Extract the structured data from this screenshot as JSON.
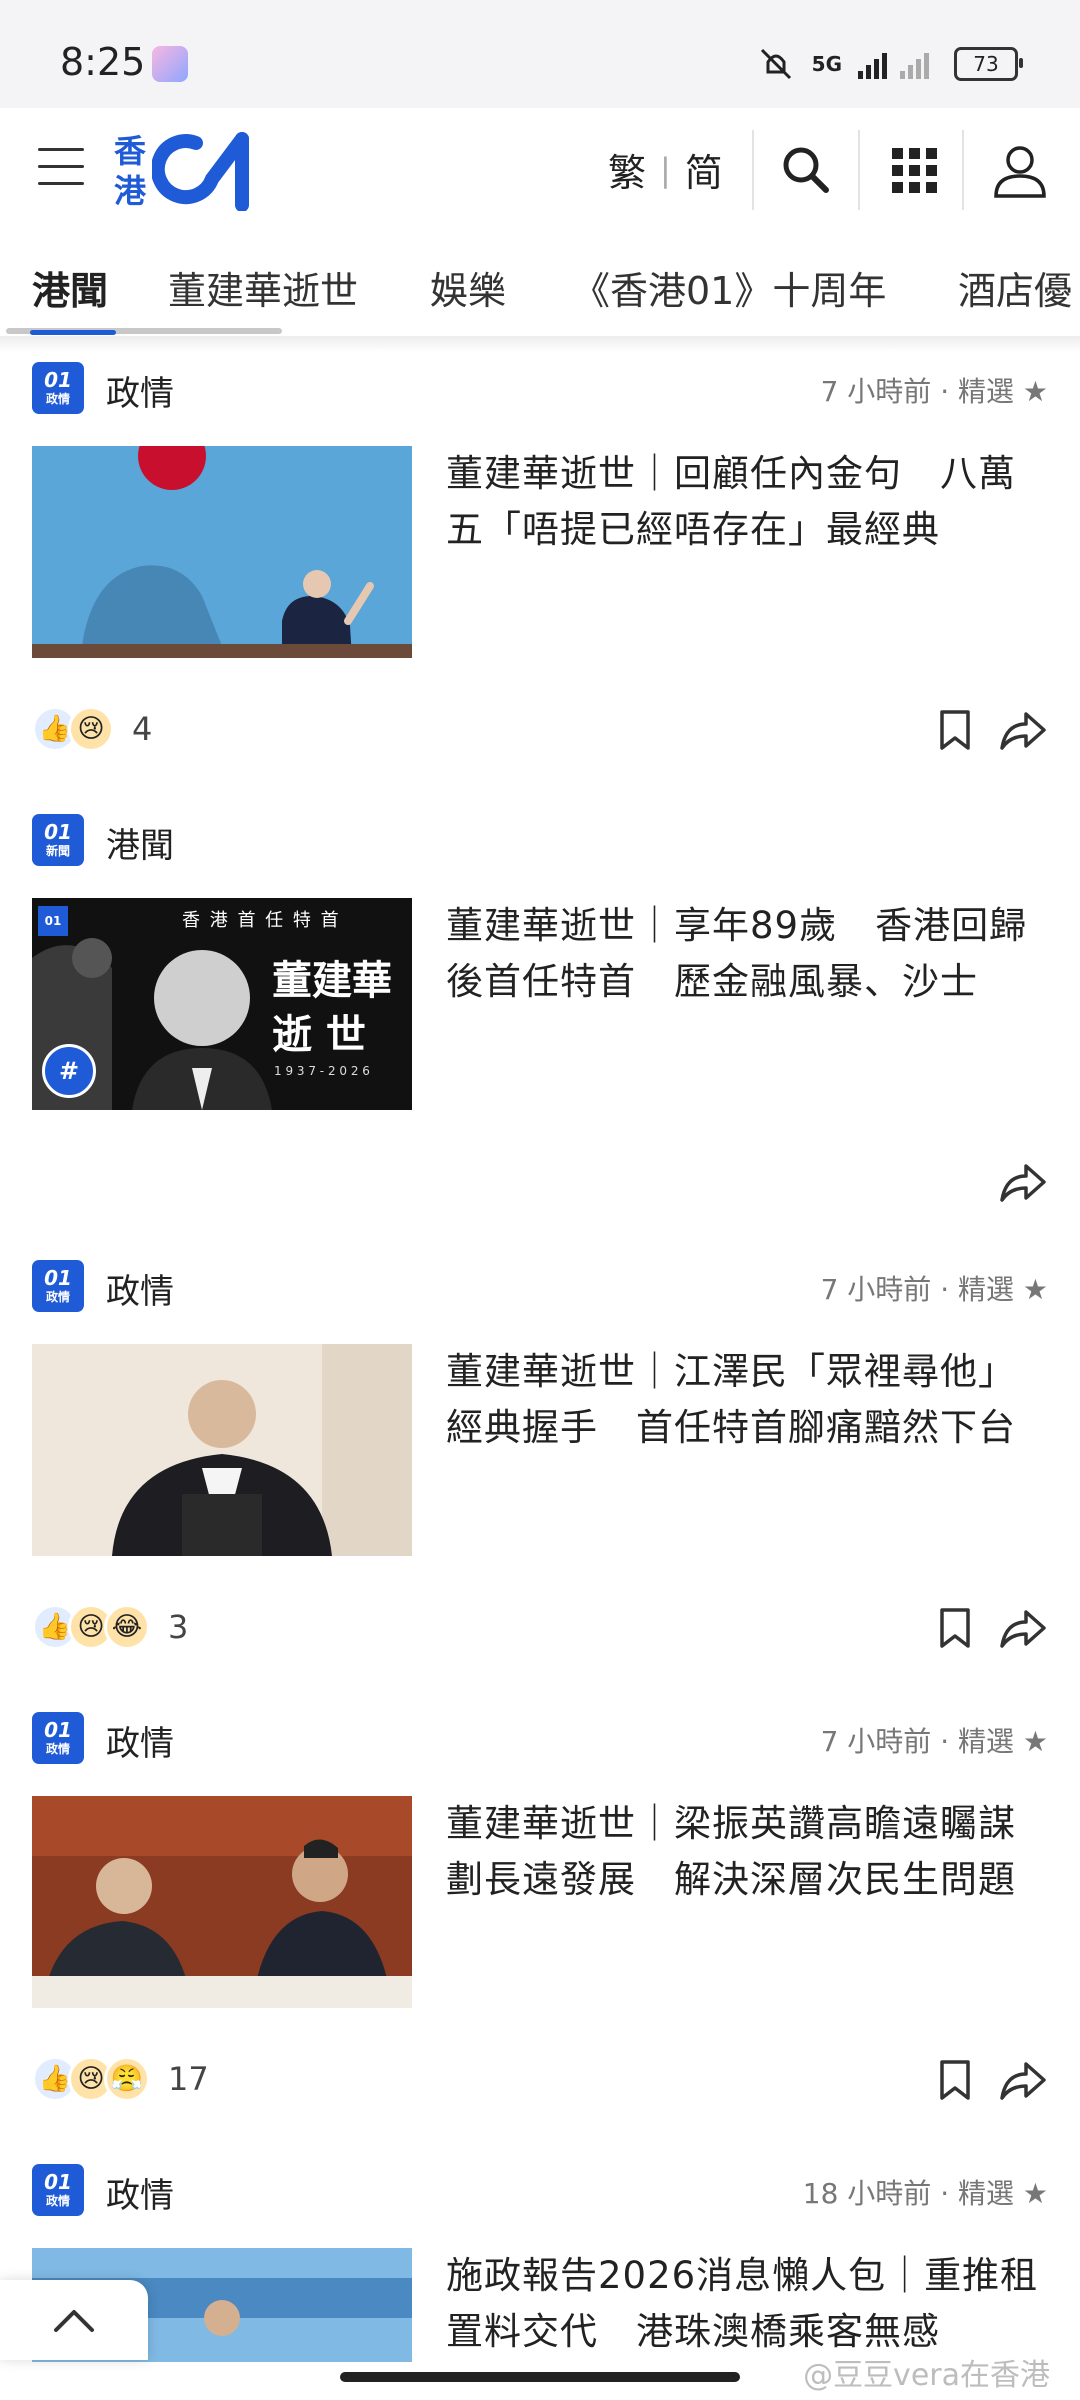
{
  "status_bar": {
    "time": "8:25",
    "network": "5G",
    "battery": "73"
  },
  "header": {
    "logo_cn_top": "香",
    "logo_cn_bottom": "港",
    "lang_trad": "繁",
    "lang_simp": "简"
  },
  "tabs": [
    {
      "label": "港聞",
      "active": true
    },
    {
      "label": "董建華逝世"
    },
    {
      "label": "娛樂"
    },
    {
      "label": "《香港01》十周年"
    },
    {
      "label": "酒店優"
    }
  ],
  "articles": [
    {
      "source_logo": "政情",
      "category": "政情",
      "meta": "7 小時前 · 精選 ★",
      "title": "董建華逝世｜回顧任內金句　八萬五「唔提已經唔存在」最經典",
      "reaction_count": "4"
    },
    {
      "source_logo": "新聞",
      "category": "港聞",
      "meta": "",
      "title": "董建華逝世｜享年89歲　香港回歸後首任特首　歷金融風暴、沙士",
      "thumb_header": "香 港 首 任 特 首",
      "thumb_name": "董建華",
      "thumb_event": "逝 世",
      "thumb_years": "1 9 3 7  -  2 0 2 6",
      "thumb_badge": "#"
    },
    {
      "source_logo": "政情",
      "category": "政情",
      "meta": "7 小時前 · 精選 ★",
      "title": "董建華逝世｜江澤民「眾裡尋他」經典握手　首任特首腳痛黯然下台",
      "reaction_count": "3"
    },
    {
      "source_logo": "政情",
      "category": "政情",
      "meta": "7 小時前 · 精選 ★",
      "title": "董建華逝世｜梁振英讚高瞻遠矚謀劃長遠發展　解決深層次民生問題",
      "reaction_count": "17"
    },
    {
      "source_logo": "政情",
      "category": "政情",
      "meta": "18 小時前 · 精選 ★",
      "title": "施政報告2026消息懶人包｜重推租置料交代　港珠澳橋乘客無感"
    }
  ],
  "watermark": "@豆豆vera在香港",
  "colors": {
    "brand": "#1f5bd6",
    "text": "#222222",
    "meta": "#777777"
  }
}
